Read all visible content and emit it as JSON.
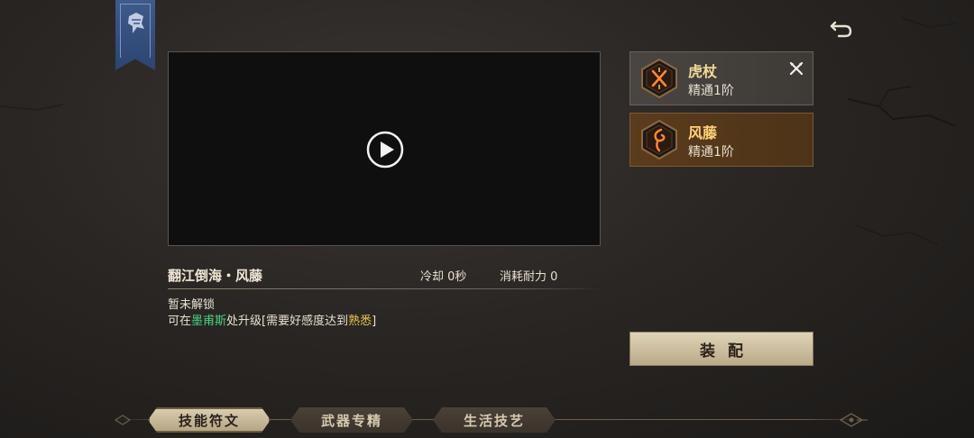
{
  "video": {
    "play_icon": "play-circle-icon"
  },
  "skill": {
    "name": "翻江倒海・风藤",
    "cooldown": "冷却 0秒",
    "stamina_cost": "消耗耐力 0",
    "status": "暂未解锁",
    "unlock_prefix": "可在",
    "unlock_npc": "墨甫斯",
    "unlock_middle": "处升级[需要好感度达到",
    "unlock_level": "熟悉",
    "unlock_suffix": "]"
  },
  "weapons": [
    {
      "name": "虎杖",
      "mastery": "精通1阶",
      "icon": "crossed-rune-icon",
      "equipped": true
    },
    {
      "name": "风藤",
      "mastery": "精通1阶",
      "icon": "spiral-rune-icon",
      "selected": true
    }
  ],
  "equip_button": "装配",
  "tabs": [
    {
      "label": "技能符文",
      "active": true
    },
    {
      "label": "武器专精",
      "active": false
    },
    {
      "label": "生活技艺",
      "active": false
    }
  ],
  "colors": {
    "npc_name": "#4bd07c",
    "level_name": "#e8c64a",
    "selected_card": "#5b3c1c",
    "banner": "#3f5a8c"
  }
}
